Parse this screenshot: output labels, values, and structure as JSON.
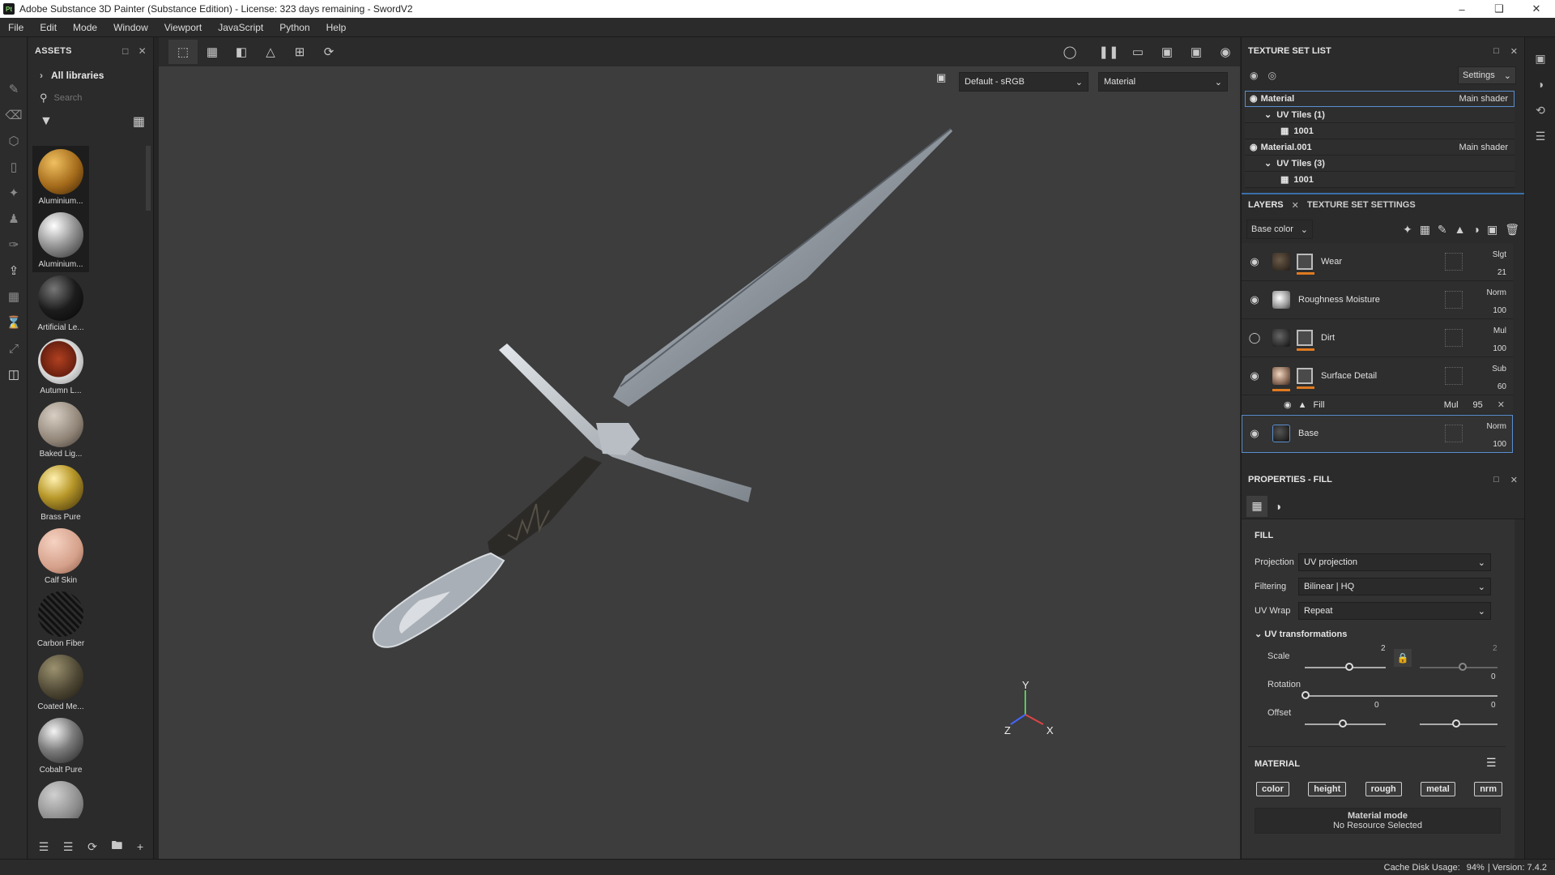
{
  "window": {
    "title": "Adobe Substance 3D Painter (Substance Edition) - License: 323 days remaining - SwordV2",
    "logo": "Pt"
  },
  "menu": [
    "File",
    "Edit",
    "Mode",
    "Window",
    "Viewport",
    "JavaScript",
    "Python",
    "Help"
  ],
  "assets": {
    "title": "ASSETS",
    "library": "All libraries",
    "search_placeholder": "Search",
    "items": [
      "Aluminium...",
      "Aluminium...",
      "Artificial Le...",
      "Autumn L...",
      "Baked Lig...",
      "Brass Pure",
      "Calf Skin",
      "Carbon Fiber",
      "Coated Me...",
      "Cobalt Pure",
      ""
    ]
  },
  "viewport": {
    "colorspace": "Default - sRGB",
    "channel": "Material",
    "axes": {
      "x": "X",
      "y": "Y",
      "z": "Z"
    }
  },
  "texture_set_list": {
    "title": "TEXTURE SET LIST",
    "settings_label": "Settings",
    "rows": [
      {
        "name": "Material",
        "shader": "Main shader"
      },
      {
        "name": "UV Tiles (1)",
        "shader": ""
      },
      {
        "name": "1001",
        "shader": ""
      },
      {
        "name": "Material.001",
        "shader": "Main shader"
      },
      {
        "name": "UV Tiles (3)",
        "shader": ""
      },
      {
        "name": "1001",
        "shader": ""
      }
    ]
  },
  "layers": {
    "tab_layers": "LAYERS",
    "tab_settings": "TEXTURE SET SETTINGS",
    "channel": "Base color",
    "items": [
      {
        "name": "Wear",
        "blend": "Slgt",
        "opacity": "21"
      },
      {
        "name": "Roughness Moisture",
        "blend": "Norm",
        "opacity": "100"
      },
      {
        "name": "Dirt",
        "blend": "Mul",
        "opacity": "100"
      },
      {
        "name": "Surface Detail",
        "blend": "Sub",
        "opacity": "60"
      },
      {
        "name": "Base",
        "blend": "Norm",
        "opacity": "100"
      }
    ],
    "fill_sub": {
      "name": "Fill",
      "blend": "Mul",
      "opacity": "95"
    }
  },
  "properties": {
    "title": "PROPERTIES - FILL",
    "section_fill": "FILL",
    "projection_label": "Projection",
    "projection_value": "UV projection",
    "filtering_label": "Filtering",
    "filtering_value": "Bilinear | HQ",
    "uvwrap_label": "UV Wrap",
    "uvwrap_value": "Repeat",
    "uv_transform_label": "UV transformations",
    "scale_label": "Scale",
    "scale_u": "2",
    "scale_v": "2",
    "rotation_label": "Rotation",
    "rotation_value": "0",
    "offset_label": "Offset",
    "offset_u": "0",
    "offset_v": "0",
    "material_label": "MATERIAL",
    "chips": [
      "color",
      "height",
      "rough",
      "metal",
      "nrm"
    ],
    "material_mode": "Material mode",
    "no_resource": "No Resource Selected"
  },
  "status": {
    "cache": "Cache Disk Usage:",
    "cache_pct": "94%",
    "version": "| Version: 7.4.2"
  }
}
